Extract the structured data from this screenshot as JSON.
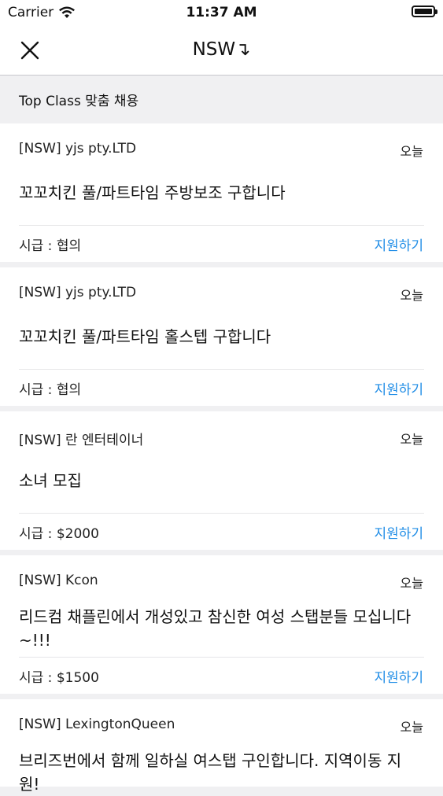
{
  "status_bar": {
    "carrier": "Carrier",
    "time": "11:37 AM",
    "battery_level": 1.0
  },
  "nav": {
    "title": "NSW↴",
    "close_icon": "close-icon"
  },
  "section": {
    "title": "Top Class 맞춤 채용"
  },
  "jobs": [
    {
      "company": "[NSW] yjs pty.LTD",
      "date": "오늘",
      "title": "꼬꼬치킨 풀/파트타임 주방보조 구합니다",
      "wage": "시급 : 협의",
      "apply": "지원하기"
    },
    {
      "company": "[NSW] yjs pty.LTD",
      "date": "오늘",
      "title": "꼬꼬치킨 풀/파트타임 홀스텝 구합니다",
      "wage": "시급 : 협의",
      "apply": "지원하기"
    },
    {
      "company": "[NSW] 란 엔터테이너",
      "date": "오늘",
      "title": "소녀 모집",
      "wage": "시급 : $2000",
      "apply": "지원하기"
    },
    {
      "company": "[NSW] Kcon",
      "date": "오늘",
      "title": "리드컴 채플린에서 개성있고 참신한 여성 스탭분들 모십니다~!!!",
      "wage": "시급 : $1500",
      "apply": "지원하기"
    },
    {
      "company": "[NSW] LexingtonQueen",
      "date": "오늘",
      "title": "브리즈번에서 함께 일하실 여스탭 구인합니다. 지역이동 지원!",
      "wage": "",
      "apply": ""
    }
  ]
}
